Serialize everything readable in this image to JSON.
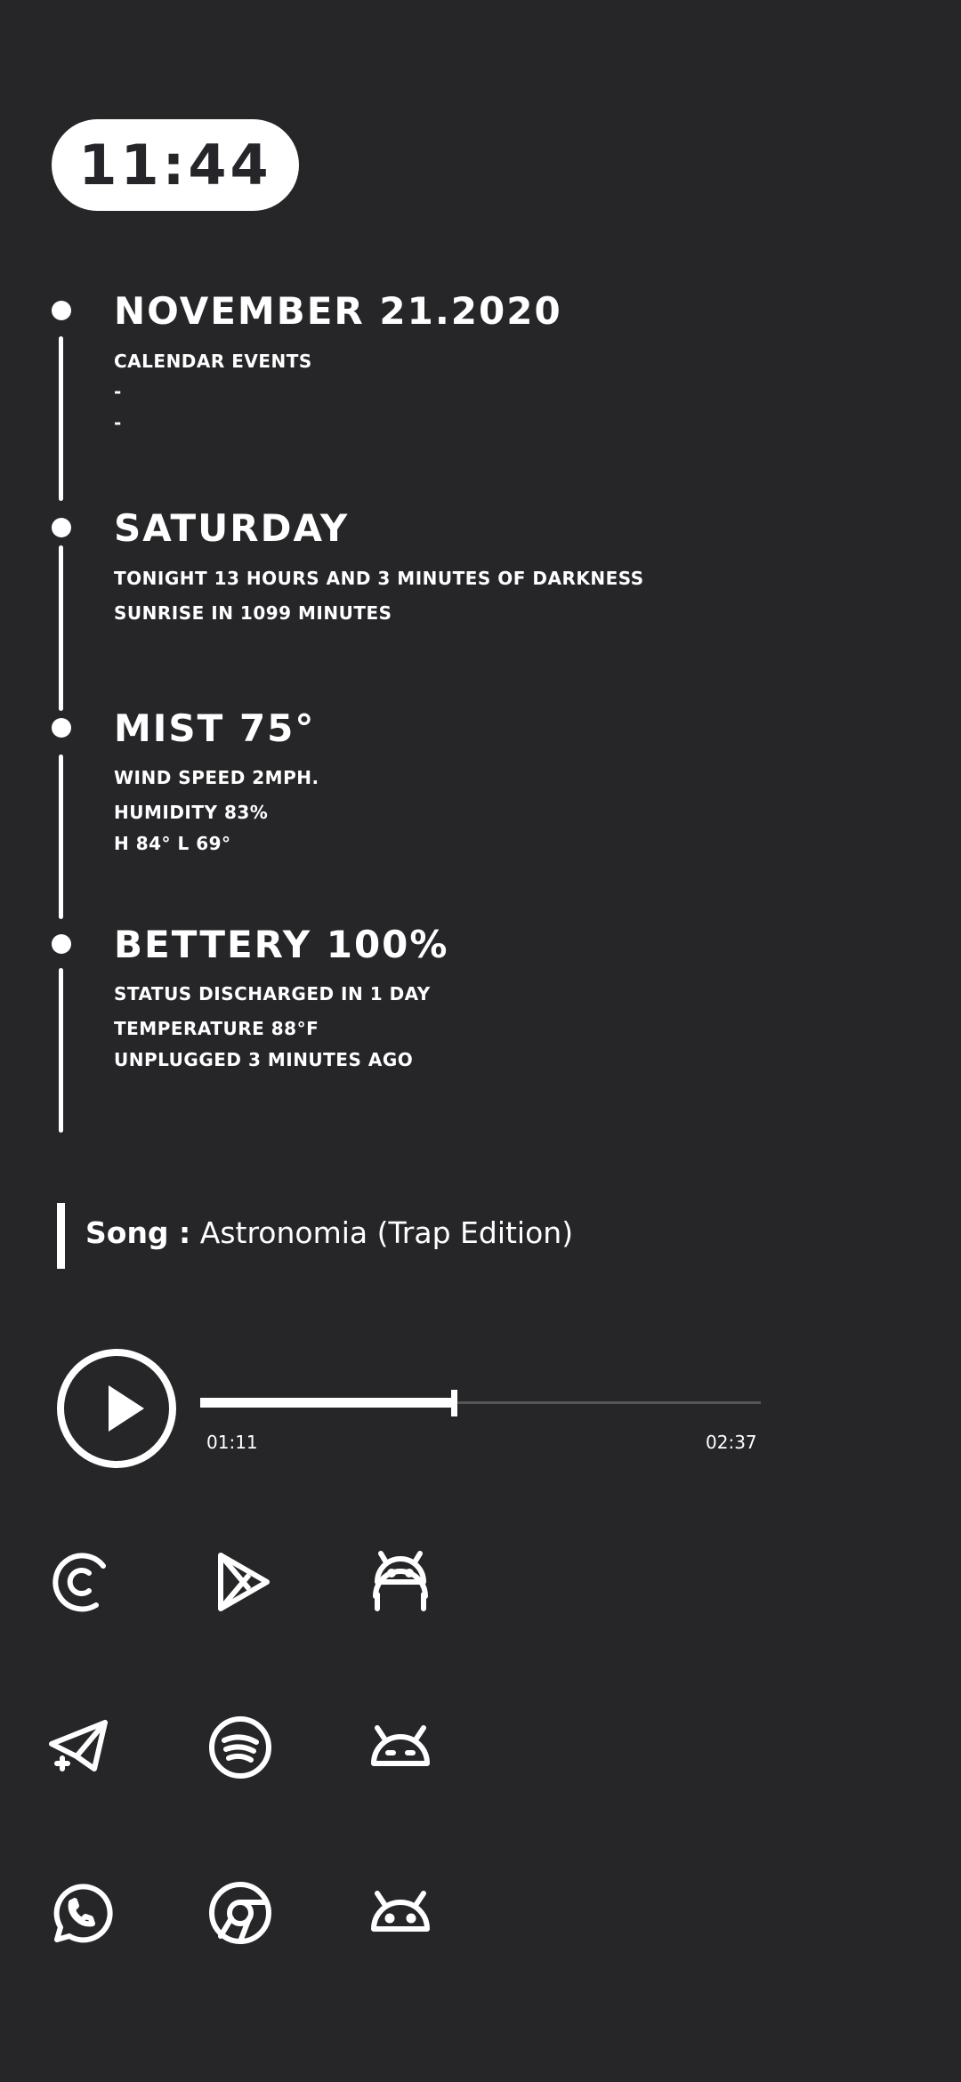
{
  "clock": {
    "time": "11:44"
  },
  "sections": [
    {
      "title": "NOVEMBER 21.2020",
      "lines": [
        "CALENDAR EVENTS",
        "-",
        "-"
      ]
    },
    {
      "title": "SATURDAY",
      "lines": [
        "TONIGHT 13 HOURS AND 3 MINUTES OF DARKNESS",
        "SUNRISE IN 1099 MINUTES"
      ]
    },
    {
      "title": "MIST 75°",
      "lines": [
        "WIND SPEED 2MPH.",
        "HUMIDITY 83%",
        "H 84° L 69°"
      ]
    },
    {
      "title": "BETTERY 100%",
      "lines": [
        "STATUS DISCHARGED IN 1 DAY",
        "TEMPERATURE 88°F",
        "UNPLUGGED 3 MINUTES AGO"
      ]
    }
  ],
  "music": {
    "song_label": "Song :",
    "song_title": "Astronomia (Trap Edition)",
    "current_time": "01:11",
    "total_time": "02:37",
    "progress": 0.452
  },
  "apps": [
    {
      "icon": "copyright-c-icon"
    },
    {
      "icon": "play-store-icon"
    },
    {
      "icon": "android-robot-icon"
    },
    {
      "icon": "telegram-icon"
    },
    {
      "icon": "spotify-icon"
    },
    {
      "icon": "android-head-icon"
    },
    {
      "icon": "whatsapp-icon"
    },
    {
      "icon": "chrome-icon"
    },
    {
      "icon": "android-head-icon"
    }
  ],
  "colors": {
    "background": "#262628",
    "foreground": "#ffffff",
    "track": "#555558"
  }
}
